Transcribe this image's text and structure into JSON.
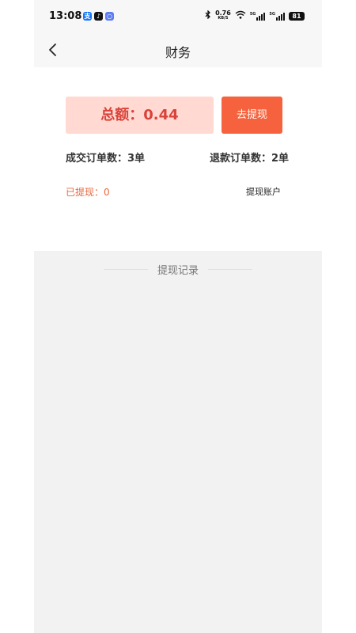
{
  "status_bar": {
    "time": "13:08",
    "app_icons": [
      {
        "name": "alipay-icon",
        "glyph": "支",
        "color": "#1677ff"
      },
      {
        "name": "douyin-icon",
        "glyph": "♪",
        "color": "#111111"
      },
      {
        "name": "browser-icon",
        "glyph": "○",
        "color": "#5b7cf5"
      }
    ],
    "network_speed": "0.76",
    "network_speed_unit": "KB/S",
    "signal1_label": "5G",
    "signal2_label": "5G",
    "battery": "81"
  },
  "nav": {
    "title": "财务"
  },
  "summary": {
    "total_label": "总额：0.44",
    "withdraw_button": "去提现",
    "deal_orders": "成交订单数：3单",
    "refund_orders": "退款订单数：2单",
    "withdrawn": "已提现：0",
    "withdraw_account": "提现账户"
  },
  "records": {
    "title": "提现记录"
  },
  "colors": {
    "accent": "#f6623d",
    "total_bg": "#ffd9d2",
    "total_text": "#d9433a",
    "withdrawn_text": "#e8693f"
  }
}
